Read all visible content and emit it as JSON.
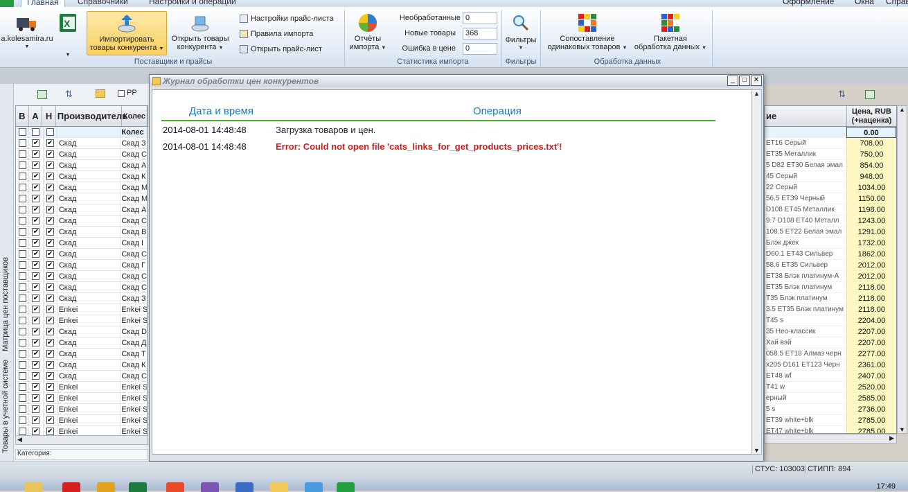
{
  "tabs": {
    "main": "Главная",
    "reference": "Справочники",
    "settings": "Настройки и операции"
  },
  "right_menu": {
    "design": "Оформление",
    "windows": "Окна",
    "help": "Справ"
  },
  "ribbon": {
    "supplier_label": "a.kolesamira.ru",
    "import_competitor": [
      "Импортировать",
      "товары конкурента"
    ],
    "open_competitor": [
      "Открыть товары",
      "конкурента"
    ],
    "pricelist_settings": "Настройки прайс-листа",
    "import_rules": "Правила импорта",
    "open_pricelist": "Открыть прайс-лист",
    "group_suppliers": "Поставщики и прайсы",
    "reports": [
      "Отчёты",
      "импорта"
    ],
    "stats": {
      "unprocessed_label": "Необработанные",
      "unprocessed_value": "0",
      "new_goods_label": "Новые товары",
      "new_goods_value": "368",
      "price_error_label": "Ошибка в цене",
      "price_error_value": "0"
    },
    "group_stats": "Статистика импорта",
    "filters": "Фильтры",
    "group_filters": "Фильтры",
    "match_goods": [
      "Сопоставление",
      "одинаковых товаров"
    ],
    "batch_processing": [
      "Пакетная",
      "обработка данных"
    ],
    "group_data": "Обработка данных"
  },
  "left_toolbar": {
    "pp_label": "PP"
  },
  "vertical_tabs": {
    "matrix": "Матрица цен поставщиков",
    "accounting": "Товары в учетной системе"
  },
  "left_grid": {
    "headers": [
      "В",
      "А",
      "Н",
      "Производитель",
      "Колес"
    ],
    "rows": [
      {
        "maker": "Скад",
        "model": "Скад З"
      },
      {
        "maker": "Скад",
        "model": "Скад С"
      },
      {
        "maker": "Скад",
        "model": "Скад А"
      },
      {
        "maker": "Скад",
        "model": "Скад К"
      },
      {
        "maker": "Скад",
        "model": "Скад М"
      },
      {
        "maker": "Скад",
        "model": "Скад М"
      },
      {
        "maker": "Скад",
        "model": "Скад А"
      },
      {
        "maker": "Скад",
        "model": "Скад С"
      },
      {
        "maker": "Скад",
        "model": "Скад В"
      },
      {
        "maker": "Скад",
        "model": "Скад I"
      },
      {
        "maker": "Скад",
        "model": "Скад С"
      },
      {
        "maker": "Скад",
        "model": "Скад Г"
      },
      {
        "maker": "Скад",
        "model": "Скад С"
      },
      {
        "maker": "Скад",
        "model": "Скад С"
      },
      {
        "maker": "Скад",
        "model": "Скад З"
      },
      {
        "maker": "Enkei",
        "model": "Enkei S"
      },
      {
        "maker": "Enkei",
        "model": "Enkei S"
      },
      {
        "maker": "Скад",
        "model": "Скад D"
      },
      {
        "maker": "Скад",
        "model": "Скад Д"
      },
      {
        "maker": "Скад",
        "model": "Скад Т"
      },
      {
        "maker": "Скад",
        "model": "Скад К"
      },
      {
        "maker": "Скад",
        "model": "Скад С"
      },
      {
        "maker": "Enkei",
        "model": "Enkei S"
      },
      {
        "maker": "Enkei",
        "model": "Enkei S"
      },
      {
        "maker": "Enkei",
        "model": "Enkei S"
      },
      {
        "maker": "Enkei",
        "model": "Enkei S"
      },
      {
        "maker": "Enkei",
        "model": "Enkei S"
      }
    ],
    "category_label": "Категория:"
  },
  "right_grid": {
    "name_header": "ие",
    "price_header": [
      "Цена, RUB",
      "(+наценка)"
    ],
    "filter_value": "0.00",
    "rows": [
      {
        "name": "ET16 Серый",
        "price": "708.00"
      },
      {
        "name": "ET35 Металлик",
        "price": "750.00"
      },
      {
        "name": "5 D82 ET30 Белая эмал",
        "price": "854.00"
      },
      {
        "name": "45 Серый",
        "price": "948.00"
      },
      {
        "name": "22 Серый",
        "price": "1034.00"
      },
      {
        "name": "56.5 ET39 Черный",
        "price": "1150.00"
      },
      {
        "name": "D108 ET45 Металлик",
        "price": "1198.00"
      },
      {
        "name": "9.7 D108 ET40 Металл",
        "price": "1243.00"
      },
      {
        "name": "108.5 ET22 Белая эмал",
        "price": "1291.00"
      },
      {
        "name": "Блэк джек",
        "price": "1732.00"
      },
      {
        "name": "D60.1 ET43 Сильвер",
        "price": "1862.00"
      },
      {
        "name": "58.6 ET35 Сильвер",
        "price": "2012.00"
      },
      {
        "name": "ET38 Блэк платинум-А",
        "price": "2012.00"
      },
      {
        "name": "ET35 Блэк платинум",
        "price": "2118.00"
      },
      {
        "name": "T35 Блэк платинум",
        "price": "2118.00"
      },
      {
        "name": "3.5 ET35 Блэк платинум",
        "price": "2118.00"
      },
      {
        "name": "T45 s",
        "price": "2204.00"
      },
      {
        "name": "35 Нео-классик",
        "price": "2207.00"
      },
      {
        "name": "Хай вэй",
        "price": "2207.00"
      },
      {
        "name": "058.5 ET18 Алмаз черн",
        "price": "2277.00"
      },
      {
        "name": "x205 D161 ET123 Черн",
        "price": "2361.00"
      },
      {
        "name": "ET48 wf",
        "price": "2407.00"
      },
      {
        "name": "T41 w",
        "price": "2520.00"
      },
      {
        "name": "ерный",
        "price": "2585.00"
      },
      {
        "name": "5 s",
        "price": "2736.00"
      },
      {
        "name": "ET39 white+blk",
        "price": "2785.00"
      },
      {
        "name": "ET47 white+blk",
        "price": "2785.00"
      }
    ]
  },
  "dialog": {
    "title": "Журнал обработки цен конкурентов",
    "col_datetime": "Дата и время",
    "col_operation": "Операция",
    "entries": [
      {
        "datetime": "2014-08-01 14:48:48",
        "operation": "Загрузка товаров и цен.",
        "error": false
      },
      {
        "datetime": "2014-08-01 14:48:48",
        "operation": "Error: Could not open file 'cats_links_for_get_products_prices.txt'!",
        "error": true
      }
    ]
  },
  "statusbar": {
    "stus": "СТУС: 103003",
    "stipp": "СТИПП: 894"
  },
  "taskbar": {
    "clock": "17:49"
  }
}
